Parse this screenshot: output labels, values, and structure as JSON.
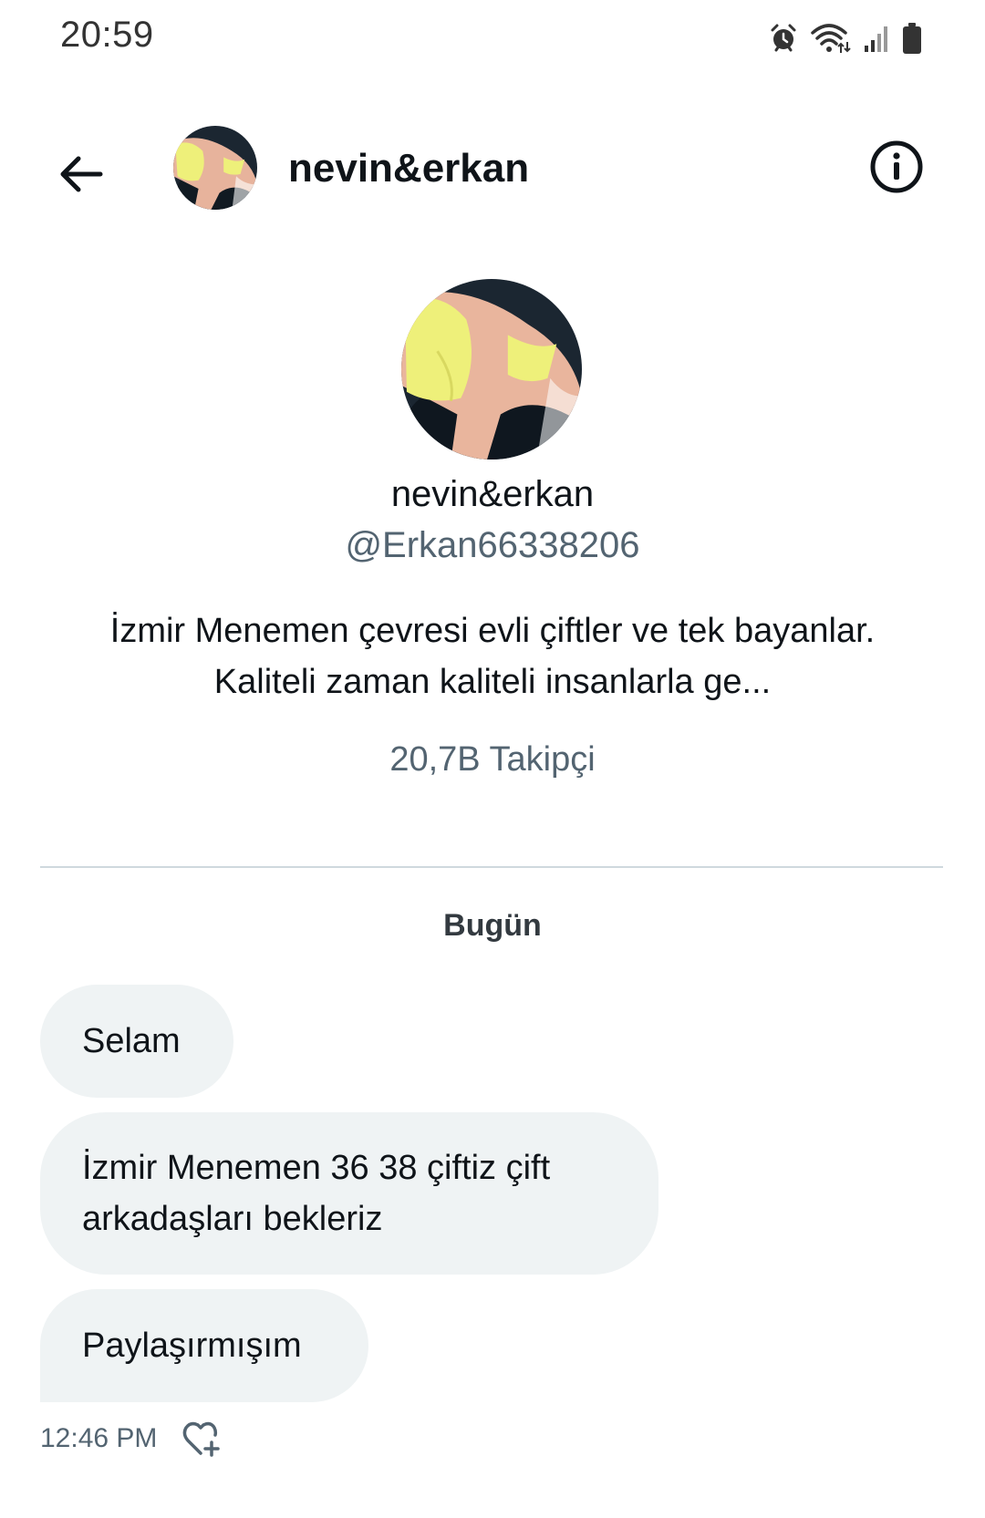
{
  "status_bar": {
    "time": "20:59",
    "icons": [
      "alarm-icon",
      "wifi-icon",
      "signal-icon",
      "battery-icon"
    ]
  },
  "header": {
    "title": "nevin&erkan",
    "back_icon": "arrow-left-icon",
    "info_icon": "info-circle-icon"
  },
  "profile": {
    "name": "nevin&erkan",
    "handle": "@Erkan66338206",
    "bio": "İzmir Menemen çevresi evli çiftler ve tek bayanlar. Kaliteli zaman kaliteli insanlarla ge...",
    "followers": "20,7B Takipçi"
  },
  "conversation": {
    "date_label": "Bugün",
    "messages": [
      {
        "text": "Selam"
      },
      {
        "text": "İzmir Menemen 36 38 çiftiz çift arkadaşları bekleriz"
      },
      {
        "text": "Paylaşırmışım"
      }
    ],
    "last_time": "12:46 PM"
  },
  "colors": {
    "bubble_bg": "#eff3f4",
    "secondary_text": "#536471",
    "divider": "#cfd9de"
  }
}
